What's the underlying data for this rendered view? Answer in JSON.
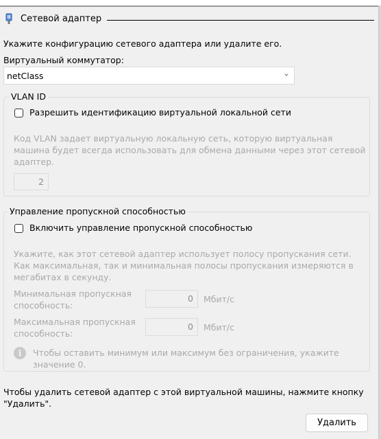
{
  "section": {
    "title": "Сетевой адаптер",
    "icon": "network-adapter-icon"
  },
  "intro_text": "Укажите конфигурацию сетевого адаптера или удалите его.",
  "switch": {
    "label": "Виртуальный коммутатор:",
    "value": "netClass",
    "icon": "chevron-down-icon"
  },
  "vlan": {
    "group_label": "VLAN ID",
    "checkbox_label": "Разрешить идентификацию виртуальной локальной сети",
    "checked": false,
    "description_lines": [
      "Код VLAN задает виртуальную локальную сеть, которую виртуальная",
      "машина будет всегда использовать для обмена данными через этот сетевой",
      "адаптер."
    ],
    "id_value": "2"
  },
  "bandwidth": {
    "group_label": "Управление пропускной способностью",
    "checkbox_label": "Включить управление пропускной способностью",
    "checked": false,
    "description_lines": [
      "Укажите, как этот сетевой адаптер использует полосу пропускания сети.",
      "Как максимальная, так и минимальная полосы пропускания измеряются в",
      "мегабитах в секунду."
    ],
    "min": {
      "label_lines": [
        "Минимальная пропускная",
        "способность:"
      ],
      "value": "0",
      "unit": "Мбит/с"
    },
    "max": {
      "label_lines": [
        "Максимальная пропускная",
        "способность:"
      ],
      "value": "0",
      "unit": "Мбит/с"
    },
    "info": {
      "icon": "info-icon",
      "lines": [
        "Чтобы оставить минимум или максимум без ограничения, укажите",
        "значение 0."
      ]
    }
  },
  "remove_text_lines": [
    "Чтобы удалить сетевой адаптер с этой виртуальной машины, нажмите кнопку",
    "\"Удалить\"."
  ],
  "remove_button_label": "Удалить"
}
